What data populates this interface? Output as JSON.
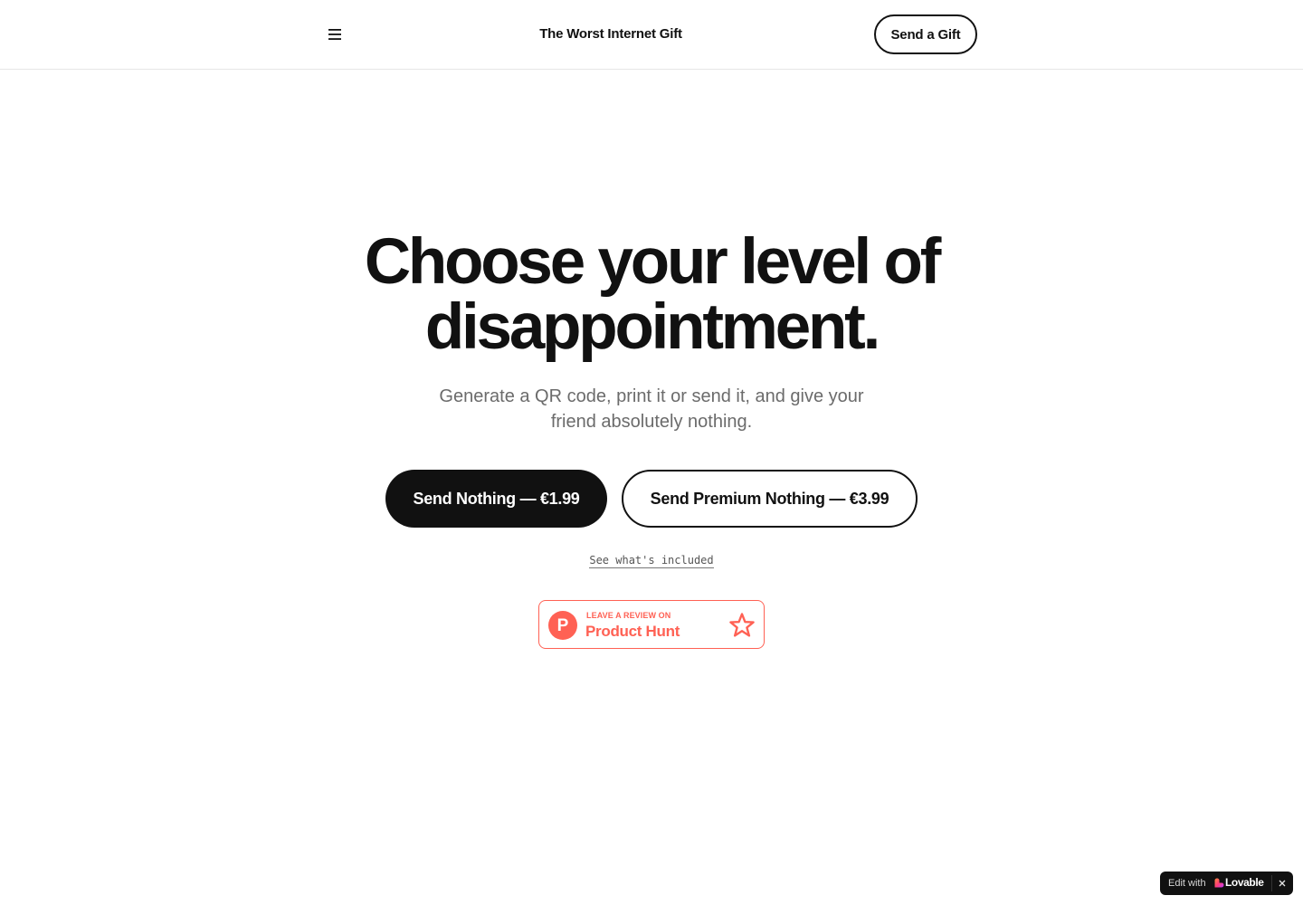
{
  "header": {
    "site_title": "The Worst Internet Gift",
    "menu_icon": "hamburger-menu-icon",
    "cta_label": "Send a Gift"
  },
  "hero": {
    "title_line1": "Choose your level of",
    "title_line2": "disappointment.",
    "subtitle_line1": "Generate a QR code, print it or send it, and give your",
    "subtitle_line2": "friend absolutely nothing.",
    "primary_button": "Send Nothing — €1.99",
    "secondary_button": "Send Premium Nothing — €3.99",
    "included_link": "See what's included"
  },
  "product_hunt": {
    "small_label": "LEAVE A REVIEW ON",
    "brand": "Product Hunt",
    "logo_letter": "P",
    "icon": "star-outline-icon",
    "color": "#ff6154"
  },
  "lovable_badge": {
    "edit_label": "Edit with",
    "brand": "Lovable",
    "close_icon": "close-icon"
  },
  "colors": {
    "text": "#111111",
    "muted": "#6b6b6b",
    "accent": "#ff6154"
  }
}
